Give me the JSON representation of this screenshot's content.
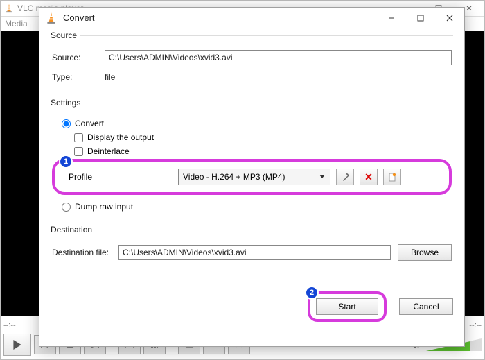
{
  "main_window": {
    "title": "VLC media player",
    "menu_first": "Media",
    "time_left": "--:--",
    "time_right": "--:--"
  },
  "dialog": {
    "title": "Convert",
    "source": {
      "legend": "Source",
      "source_label": "Source:",
      "source_value": "C:\\Users\\ADMIN\\Videos\\xvid3.avi",
      "type_label": "Type:",
      "type_value": "file"
    },
    "settings": {
      "legend": "Settings",
      "convert_label": "Convert",
      "display_label": "Display the output",
      "deinterlace_label": "Deinterlace",
      "profile_label": "Profile",
      "profile_value": "Video - H.264 + MP3 (MP4)",
      "dump_label": "Dump raw input"
    },
    "destination": {
      "legend": "Destination",
      "label": "Destination file:",
      "value": "C:\\Users\\ADMIN\\Videos\\xvid3.avi",
      "browse": "Browse"
    },
    "buttons": {
      "start": "Start",
      "cancel": "Cancel"
    },
    "badges": {
      "one": "1",
      "two": "2"
    }
  }
}
